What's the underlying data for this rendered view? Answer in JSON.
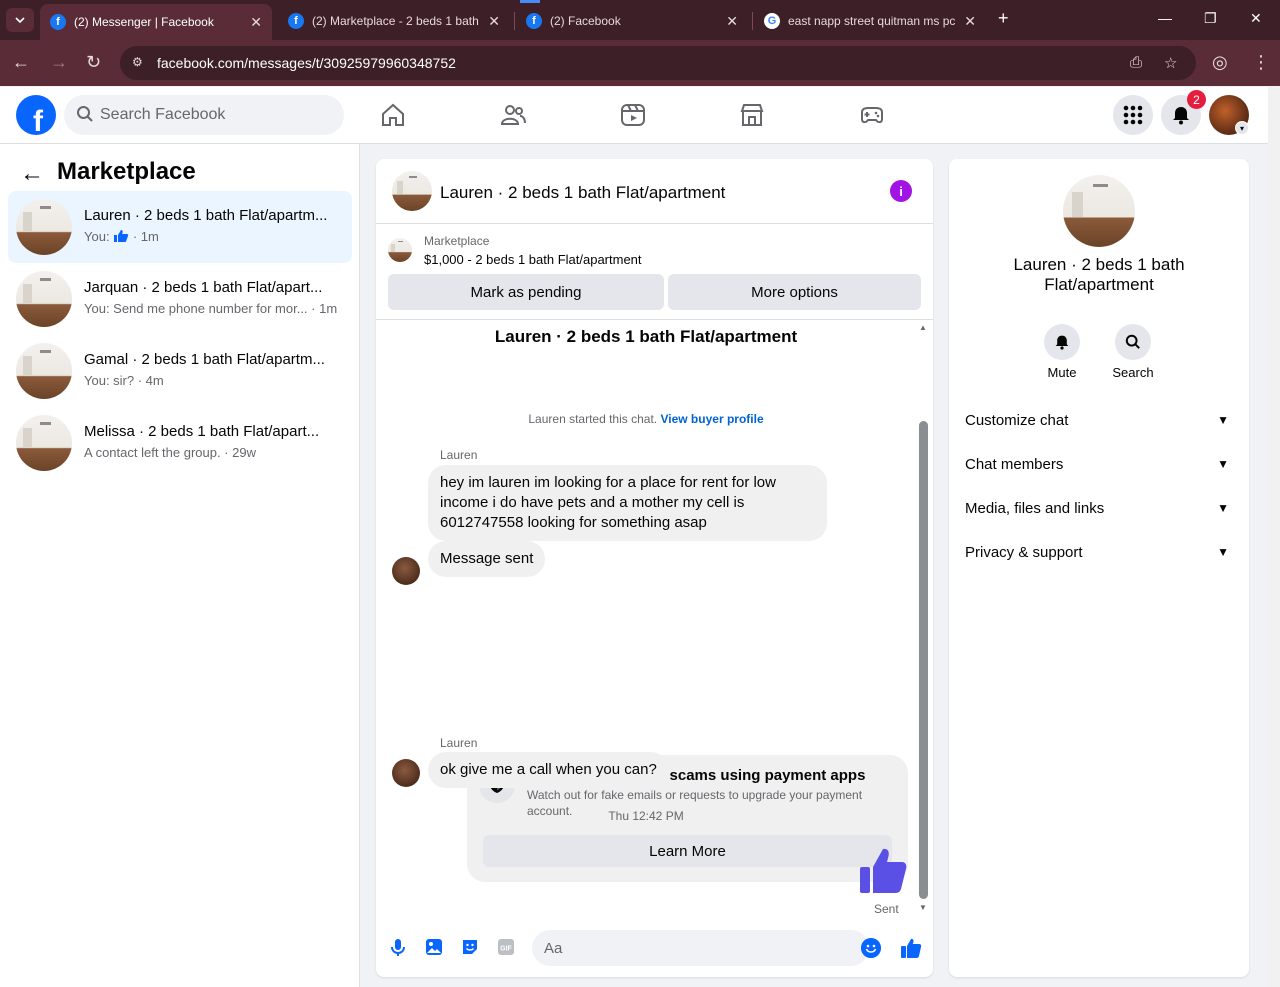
{
  "browser": {
    "tabs": [
      {
        "title": "(2) Messenger | Facebook",
        "icon": "facebook-icon",
        "active": true
      },
      {
        "title": "(2) Marketplace - 2 beds 1 bath",
        "icon": "facebook-icon",
        "active": false
      },
      {
        "title": "(2) Facebook",
        "icon": "facebook-icon",
        "active": false
      },
      {
        "title": "east napp street quitman ms pc",
        "icon": "google-icon",
        "active": false
      }
    ],
    "url": "facebook.com/messages/t/30925979960348752"
  },
  "fb_header": {
    "search_placeholder": "Search Facebook",
    "notification_count": "2"
  },
  "left_panel": {
    "title": "Marketplace",
    "conversations": [
      {
        "name": "Lauren · 2 beds 1 bath Flat/apartm...",
        "preview": "You:",
        "time": "· 1m",
        "has_like": true,
        "selected": true
      },
      {
        "name": "Jarquan · 2 beds 1 bath Flat/apart...",
        "preview": "You: Send me phone number for mor...",
        "time": "· 1m"
      },
      {
        "name": "Gamal · 2 beds 1 bath Flat/apartm...",
        "preview": "You: sir?",
        "time": "· 4m"
      },
      {
        "name": "Melissa · 2 beds 1 bath Flat/apart...",
        "preview": "A contact left the group.",
        "time": "· 29w"
      }
    ]
  },
  "chat": {
    "header_name": "Lauren · 2 beds 1 bath Flat/apartment",
    "marketplace_label": "Marketplace",
    "listing": "$1,000 - 2 beds 1 bath Flat/apartment",
    "mark_pending": "Mark as pending",
    "more_options": "More options",
    "thread_title": "Lauren · 2 beds 1 bath Flat/apartment",
    "started_text": "Lauren started this chat.",
    "view_profile": "View buyer profile",
    "sender1": "Lauren",
    "msg1": "hey im lauren im looking for a place for rent for low income i do have pets and a mother my cell is 6012747558 looking for something asap",
    "msg2": "Message sent",
    "scam_title": "Beware of common scams using payment apps",
    "scam_desc": "Watch out for fake emails or requests to upgrade your payment account.",
    "learn_more": "Learn More",
    "sender2": "Lauren",
    "msg3": "ok give me a call when you can?",
    "timestamp": "Thu 12:42 PM",
    "sent_status": "Sent",
    "composer_placeholder": "Aa"
  },
  "right_panel": {
    "title": "Lauren · 2 beds 1 bath Flat/apartment",
    "mute": "Mute",
    "search": "Search",
    "sections": [
      "Customize chat",
      "Chat members",
      "Media, files and links",
      "Privacy & support"
    ]
  },
  "colors": {
    "accent": "#0866ff",
    "like": "#5b50e6",
    "info": "#a213e6",
    "chrome": "#3c1f27"
  }
}
